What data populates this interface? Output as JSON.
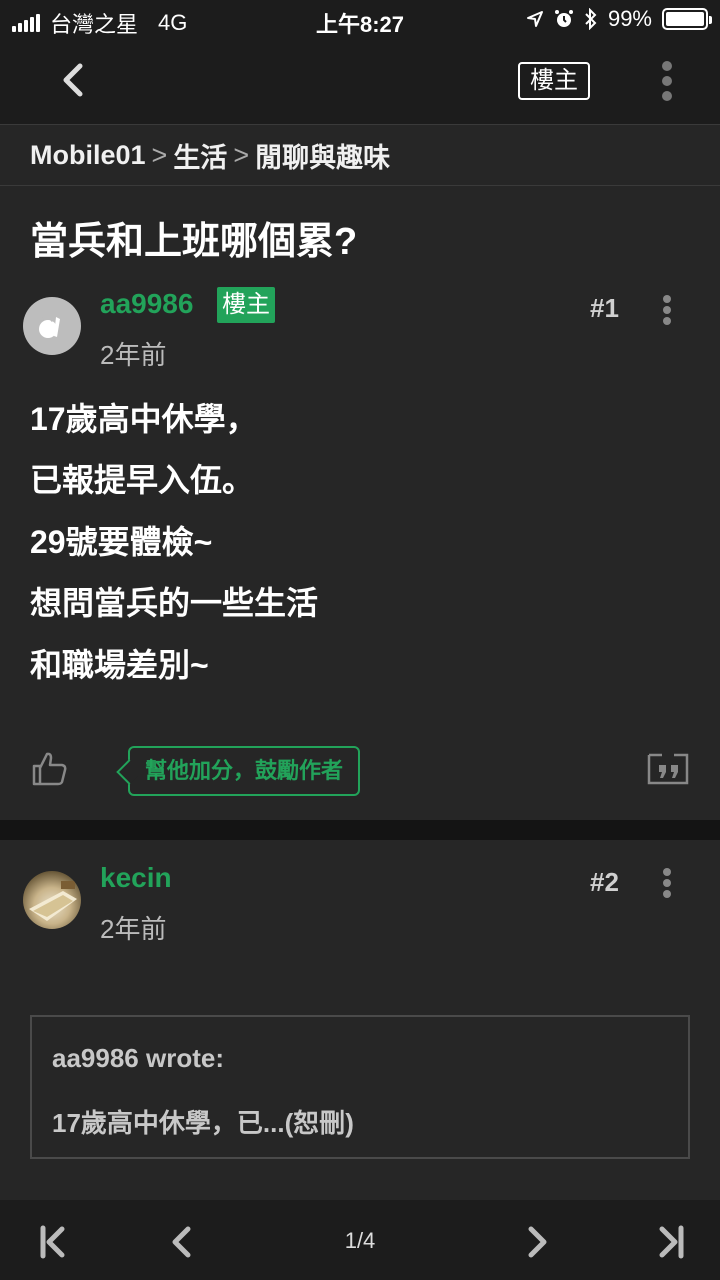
{
  "status_bar": {
    "carrier": "台灣之星",
    "network": "4G",
    "time": "上午8:27",
    "battery_percent": "99%",
    "battery_level": 0.99
  },
  "nav": {
    "back_icon": "chevron-left-icon",
    "op_filter_label": "樓主",
    "more_icon": "vertical-ellipsis-icon"
  },
  "breadcrumb": [
    "Mobile01",
    "生活",
    "閒聊與趣味"
  ],
  "thread": {
    "title": "當兵和上班哪個累?"
  },
  "posts": [
    {
      "author": "aa9986",
      "badge": "樓主",
      "time": "2年前",
      "floor": "#1",
      "body": [
        "17歲高中休學，",
        "已報提早入伍。",
        "29號要體檢~",
        "想問當兵的一些生活",
        "和職場差別~"
      ],
      "encourage_label": "幫他加分，鼓勵作者"
    },
    {
      "author": "kecin",
      "time": "2年前",
      "floor": "#2",
      "quote": {
        "author_line": "aa9986 wrote:",
        "text": "17歲高中休學，已...(恕刪)"
      }
    }
  ],
  "pagination": {
    "label": "1/4"
  },
  "colors": {
    "accent": "#22a35a",
    "background": "#262626",
    "bar": "#1c1c1c"
  }
}
